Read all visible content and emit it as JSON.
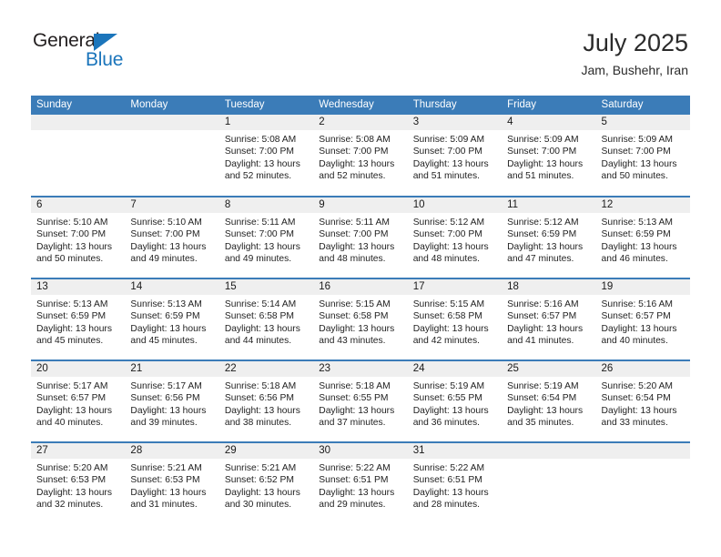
{
  "brand": {
    "name_top": "General",
    "name_bottom": "Blue",
    "triangle_color": "#1b75bb",
    "text_color": "#231f20"
  },
  "header": {
    "month_title": "July 2025",
    "location": "Jam, Bushehr, Iran"
  },
  "theme": {
    "header_blue": "#3b7cb8",
    "daynum_band": "#efefef",
    "text": "#1f1f1f"
  },
  "calendar": {
    "weekday_headers": [
      "Sunday",
      "Monday",
      "Tuesday",
      "Wednesday",
      "Thursday",
      "Friday",
      "Saturday"
    ],
    "weeks": [
      [
        {
          "day": "",
          "blank": true,
          "sunrise": "",
          "sunset": "",
          "daylight1": "",
          "daylight2": ""
        },
        {
          "day": "",
          "blank": true,
          "sunrise": "",
          "sunset": "",
          "daylight1": "",
          "daylight2": ""
        },
        {
          "day": "1",
          "blank": false,
          "sunrise": "Sunrise: 5:08 AM",
          "sunset": "Sunset: 7:00 PM",
          "daylight1": "Daylight: 13 hours",
          "daylight2": "and 52 minutes."
        },
        {
          "day": "2",
          "blank": false,
          "sunrise": "Sunrise: 5:08 AM",
          "sunset": "Sunset: 7:00 PM",
          "daylight1": "Daylight: 13 hours",
          "daylight2": "and 52 minutes."
        },
        {
          "day": "3",
          "blank": false,
          "sunrise": "Sunrise: 5:09 AM",
          "sunset": "Sunset: 7:00 PM",
          "daylight1": "Daylight: 13 hours",
          "daylight2": "and 51 minutes."
        },
        {
          "day": "4",
          "blank": false,
          "sunrise": "Sunrise: 5:09 AM",
          "sunset": "Sunset: 7:00 PM",
          "daylight1": "Daylight: 13 hours",
          "daylight2": "and 51 minutes."
        },
        {
          "day": "5",
          "blank": false,
          "sunrise": "Sunrise: 5:09 AM",
          "sunset": "Sunset: 7:00 PM",
          "daylight1": "Daylight: 13 hours",
          "daylight2": "and 50 minutes."
        }
      ],
      [
        {
          "day": "6",
          "blank": false,
          "sunrise": "Sunrise: 5:10 AM",
          "sunset": "Sunset: 7:00 PM",
          "daylight1": "Daylight: 13 hours",
          "daylight2": "and 50 minutes."
        },
        {
          "day": "7",
          "blank": false,
          "sunrise": "Sunrise: 5:10 AM",
          "sunset": "Sunset: 7:00 PM",
          "daylight1": "Daylight: 13 hours",
          "daylight2": "and 49 minutes."
        },
        {
          "day": "8",
          "blank": false,
          "sunrise": "Sunrise: 5:11 AM",
          "sunset": "Sunset: 7:00 PM",
          "daylight1": "Daylight: 13 hours",
          "daylight2": "and 49 minutes."
        },
        {
          "day": "9",
          "blank": false,
          "sunrise": "Sunrise: 5:11 AM",
          "sunset": "Sunset: 7:00 PM",
          "daylight1": "Daylight: 13 hours",
          "daylight2": "and 48 minutes."
        },
        {
          "day": "10",
          "blank": false,
          "sunrise": "Sunrise: 5:12 AM",
          "sunset": "Sunset: 7:00 PM",
          "daylight1": "Daylight: 13 hours",
          "daylight2": "and 48 minutes."
        },
        {
          "day": "11",
          "blank": false,
          "sunrise": "Sunrise: 5:12 AM",
          "sunset": "Sunset: 6:59 PM",
          "daylight1": "Daylight: 13 hours",
          "daylight2": "and 47 minutes."
        },
        {
          "day": "12",
          "blank": false,
          "sunrise": "Sunrise: 5:13 AM",
          "sunset": "Sunset: 6:59 PM",
          "daylight1": "Daylight: 13 hours",
          "daylight2": "and 46 minutes."
        }
      ],
      [
        {
          "day": "13",
          "blank": false,
          "sunrise": "Sunrise: 5:13 AM",
          "sunset": "Sunset: 6:59 PM",
          "daylight1": "Daylight: 13 hours",
          "daylight2": "and 45 minutes."
        },
        {
          "day": "14",
          "blank": false,
          "sunrise": "Sunrise: 5:13 AM",
          "sunset": "Sunset: 6:59 PM",
          "daylight1": "Daylight: 13 hours",
          "daylight2": "and 45 minutes."
        },
        {
          "day": "15",
          "blank": false,
          "sunrise": "Sunrise: 5:14 AM",
          "sunset": "Sunset: 6:58 PM",
          "daylight1": "Daylight: 13 hours",
          "daylight2": "and 44 minutes."
        },
        {
          "day": "16",
          "blank": false,
          "sunrise": "Sunrise: 5:15 AM",
          "sunset": "Sunset: 6:58 PM",
          "daylight1": "Daylight: 13 hours",
          "daylight2": "and 43 minutes."
        },
        {
          "day": "17",
          "blank": false,
          "sunrise": "Sunrise: 5:15 AM",
          "sunset": "Sunset: 6:58 PM",
          "daylight1": "Daylight: 13 hours",
          "daylight2": "and 42 minutes."
        },
        {
          "day": "18",
          "blank": false,
          "sunrise": "Sunrise: 5:16 AM",
          "sunset": "Sunset: 6:57 PM",
          "daylight1": "Daylight: 13 hours",
          "daylight2": "and 41 minutes."
        },
        {
          "day": "19",
          "blank": false,
          "sunrise": "Sunrise: 5:16 AM",
          "sunset": "Sunset: 6:57 PM",
          "daylight1": "Daylight: 13 hours",
          "daylight2": "and 40 minutes."
        }
      ],
      [
        {
          "day": "20",
          "blank": false,
          "sunrise": "Sunrise: 5:17 AM",
          "sunset": "Sunset: 6:57 PM",
          "daylight1": "Daylight: 13 hours",
          "daylight2": "and 40 minutes."
        },
        {
          "day": "21",
          "blank": false,
          "sunrise": "Sunrise: 5:17 AM",
          "sunset": "Sunset: 6:56 PM",
          "daylight1": "Daylight: 13 hours",
          "daylight2": "and 39 minutes."
        },
        {
          "day": "22",
          "blank": false,
          "sunrise": "Sunrise: 5:18 AM",
          "sunset": "Sunset: 6:56 PM",
          "daylight1": "Daylight: 13 hours",
          "daylight2": "and 38 minutes."
        },
        {
          "day": "23",
          "blank": false,
          "sunrise": "Sunrise: 5:18 AM",
          "sunset": "Sunset: 6:55 PM",
          "daylight1": "Daylight: 13 hours",
          "daylight2": "and 37 minutes."
        },
        {
          "day": "24",
          "blank": false,
          "sunrise": "Sunrise: 5:19 AM",
          "sunset": "Sunset: 6:55 PM",
          "daylight1": "Daylight: 13 hours",
          "daylight2": "and 36 minutes."
        },
        {
          "day": "25",
          "blank": false,
          "sunrise": "Sunrise: 5:19 AM",
          "sunset": "Sunset: 6:54 PM",
          "daylight1": "Daylight: 13 hours",
          "daylight2": "and 35 minutes."
        },
        {
          "day": "26",
          "blank": false,
          "sunrise": "Sunrise: 5:20 AM",
          "sunset": "Sunset: 6:54 PM",
          "daylight1": "Daylight: 13 hours",
          "daylight2": "and 33 minutes."
        }
      ],
      [
        {
          "day": "27",
          "blank": false,
          "sunrise": "Sunrise: 5:20 AM",
          "sunset": "Sunset: 6:53 PM",
          "daylight1": "Daylight: 13 hours",
          "daylight2": "and 32 minutes."
        },
        {
          "day": "28",
          "blank": false,
          "sunrise": "Sunrise: 5:21 AM",
          "sunset": "Sunset: 6:53 PM",
          "daylight1": "Daylight: 13 hours",
          "daylight2": "and 31 minutes."
        },
        {
          "day": "29",
          "blank": false,
          "sunrise": "Sunrise: 5:21 AM",
          "sunset": "Sunset: 6:52 PM",
          "daylight1": "Daylight: 13 hours",
          "daylight2": "and 30 minutes."
        },
        {
          "day": "30",
          "blank": false,
          "sunrise": "Sunrise: 5:22 AM",
          "sunset": "Sunset: 6:51 PM",
          "daylight1": "Daylight: 13 hours",
          "daylight2": "and 29 minutes."
        },
        {
          "day": "31",
          "blank": false,
          "sunrise": "Sunrise: 5:22 AM",
          "sunset": "Sunset: 6:51 PM",
          "daylight1": "Daylight: 13 hours",
          "daylight2": "and 28 minutes."
        },
        {
          "day": "",
          "blank": true,
          "sunrise": "",
          "sunset": "",
          "daylight1": "",
          "daylight2": ""
        },
        {
          "day": "",
          "blank": true,
          "sunrise": "",
          "sunset": "",
          "daylight1": "",
          "daylight2": ""
        }
      ]
    ]
  }
}
